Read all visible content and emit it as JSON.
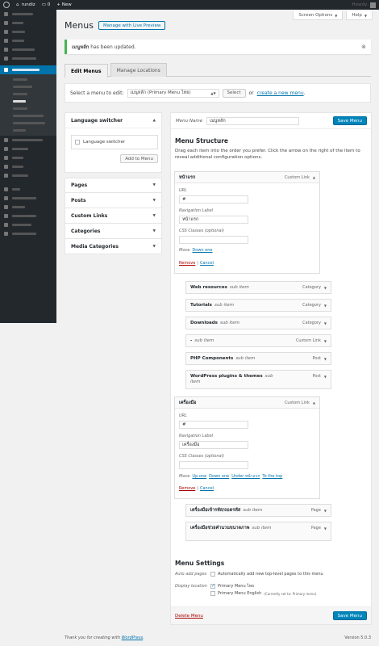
{
  "adminbar": {
    "site_name": "rundiz",
    "comments": "0",
    "new_label": "+ New",
    "howdy": "Howdy, "
  },
  "header": {
    "screen_options": "Screen Options",
    "help": "Help",
    "page_title": "Menus",
    "live_preview": "Manage with Live Preview"
  },
  "notice": {
    "menu_name": "เมนูหลัก",
    "message": " has been updated.",
    "dismiss": "⊗"
  },
  "tabs": [
    {
      "label": "Edit Menus"
    },
    {
      "label": "Manage Locations"
    }
  ],
  "select_bar": {
    "label": "Select a menu to edit:",
    "selected": "เมนูหลัก (Primary Menu ไทย)",
    "select_button": "Select",
    "or_text": "or",
    "create_link": "create a new menu",
    "period": "."
  },
  "left": {
    "language_switcher": {
      "title": "Language switcher",
      "item": "Language switcher",
      "add_button": "Add to Menu"
    },
    "accordions": [
      {
        "title": "Pages"
      },
      {
        "title": "Posts"
      },
      {
        "title": "Custom Links"
      },
      {
        "title": "Categories"
      },
      {
        "title": "Media Categories"
      }
    ]
  },
  "right": {
    "menu_name_label": "Menu Name",
    "menu_name_value": "เมนูหลัก",
    "save_button": "Save Menu",
    "structure_title": "Menu Structure",
    "structure_desc": "Drag each item into the order you prefer. Click the arrow on the right of the item to reveal additional configuration options.",
    "item1": {
      "title": "หน้าแรก",
      "type": "Custom Link",
      "url_label": "URL",
      "url": "#",
      "nav_label": "Navigation Label",
      "nav_value": "หน้าแรก",
      "css_label": "CSS Classes (optional)",
      "move_label": "Move",
      "move1": "Down one",
      "remove": "Remove",
      "sep": "|",
      "cancel": "Cancel"
    },
    "subitems1": [
      {
        "title": "Web resources",
        "sub": "sub item",
        "type": "Category"
      },
      {
        "title": "Tutorials",
        "sub": "sub item",
        "type": "Category"
      },
      {
        "title": "Downloads",
        "sub": "sub item",
        "type": "Category"
      },
      {
        "title": "-",
        "sub": "sub item",
        "type": "Custom Link"
      },
      {
        "title": "PHP Components",
        "sub": "sub item",
        "type": "Post"
      },
      {
        "title": "WordPress plugins & themes",
        "sub": "sub item",
        "type": "Post"
      }
    ],
    "item2": {
      "title": "เครื่องมือ",
      "type": "Custom Link",
      "url_label": "URL",
      "url": "#",
      "nav_label": "Navigation Label",
      "nav_value": "เครื่องมือ",
      "css_label": "CSS Classes (optional)",
      "move_label": "Move",
      "move1": "Up one",
      "move2": "Down one",
      "move3": "Under หน้าแรก",
      "move4": "To the top",
      "remove": "Remove",
      "sep": "|",
      "cancel": "Cancel"
    },
    "subitems2": [
      {
        "title": "เครื่องมือเข้ารหัส/ถอดรหัส",
        "sub": "sub item",
        "type": "Page"
      },
      {
        "title": "เครื่องมือช่วยคำนวนขนาดภาพ",
        "sub": "sub item",
        "type": "Page"
      }
    ],
    "settings_title": "Menu Settings",
    "auto_add_label": "Auto add pages",
    "auto_add_text": "Automatically add new top-level pages to this menu",
    "display_label": "Display location",
    "loc1": "Primary Menu ไทย",
    "loc2": "Primary Menu English",
    "loc2_note": "(Currently set to: Primary menu)",
    "delete_menu": "Delete Menu"
  },
  "footer": {
    "thanks_prefix": "Thank you for creating with ",
    "wp_link": "WordPress",
    "thanks_suffix": ".",
    "version": "Version 5.0.3"
  }
}
